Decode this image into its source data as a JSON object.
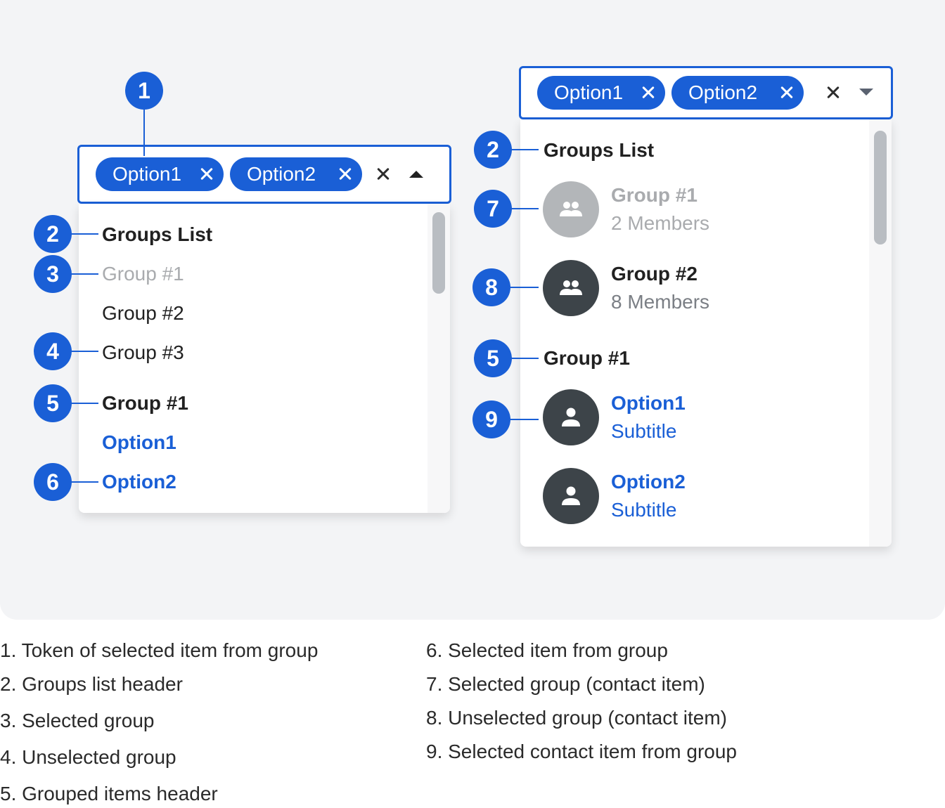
{
  "left_combo": {
    "chips": [
      "Option1",
      "Option2"
    ],
    "list": {
      "header": "Groups List",
      "groups": [
        "Group #1",
        "Group #2",
        "Group #3"
      ],
      "section_header": "Group #1",
      "options": [
        "Option1",
        "Option2"
      ]
    }
  },
  "right_combo": {
    "chips": [
      "Option1",
      "Option2"
    ],
    "list": {
      "header": "Groups List",
      "contact_groups": [
        {
          "title": "Group #1",
          "subtitle": "2 Members"
        },
        {
          "title": "Group #2",
          "subtitle": "8 Members"
        }
      ],
      "section_header": "Group #1",
      "contacts": [
        {
          "title": "Option1",
          "subtitle": "Subtitle"
        },
        {
          "title": "Option2",
          "subtitle": "Subtitle"
        }
      ]
    }
  },
  "callouts": [
    "1",
    "2",
    "3",
    "4",
    "5",
    "6",
    "7",
    "8",
    "9"
  ],
  "legend": [
    "1. Token of selected item from group",
    "2. Groups list header",
    "3. Selected group",
    "4. Unselected group",
    "5. Grouped items header",
    "6. Selected item from group",
    "7. Selected group (contact item)",
    "8. Unselected group (contact item)",
    "9. Selected contact item from group"
  ],
  "colors": {
    "accent": "#1a5fd6",
    "canvas": "#f3f4f6",
    "muted_text": "#a9abae",
    "avatar_dark": "#3d4449",
    "avatar_light": "#b3b6b9"
  },
  "icons": [
    "close-icon",
    "chevron-up-icon",
    "chevron-down-icon",
    "group-icon",
    "person-icon"
  ]
}
